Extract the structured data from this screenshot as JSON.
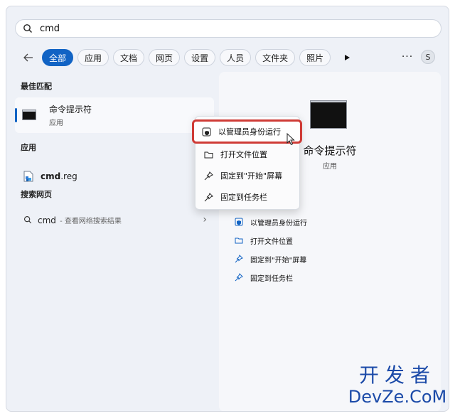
{
  "search": {
    "query": "cmd"
  },
  "filters": [
    "全部",
    "应用",
    "文档",
    "网页",
    "设置",
    "人员",
    "文件夹",
    "照片"
  ],
  "more_label": "···",
  "avatar_initial": "S",
  "sections": {
    "best_match": "最佳匹配",
    "apps": "应用",
    "web": "搜索网页"
  },
  "best_match": {
    "name": "命令提示符",
    "type": "应用"
  },
  "apps": [
    {
      "name_bold": "cmd",
      "name_rest": ".reg"
    }
  ],
  "web_search": {
    "query": "cmd",
    "sub": " - 查看网络搜索结果",
    "chevron": "›"
  },
  "detail": {
    "title": "命令提示符",
    "type": "应用",
    "actions": [
      "以管理员身份运行",
      "打开文件位置",
      "固定到\"开始\"屏幕",
      "固定到任务栏"
    ]
  },
  "context_menu": [
    "以管理员身份运行",
    "打开文件位置",
    "固定到\"开始\"屏幕",
    "固定到任务栏"
  ],
  "watermark": {
    "cn": "开发者",
    "en": "DevZe.CoM"
  },
  "colors": {
    "accent": "#1163c4",
    "highlight": "#cf3b36",
    "watermark": "#1b4aa8"
  }
}
